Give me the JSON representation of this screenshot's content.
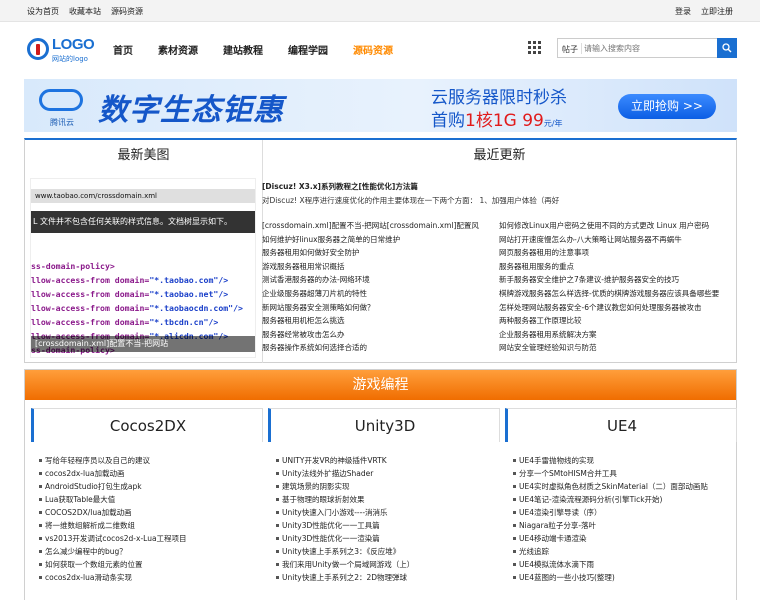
{
  "topbar": {
    "set_home": "设为首页",
    "bookmark": "收藏本站",
    "source": "源码资源",
    "login": "登录",
    "register": "立即注册"
  },
  "logo": {
    "text": "LOGO",
    "sub": "网站的logo"
  },
  "nav": [
    "首页",
    "素材资源",
    "建站教程",
    "编程学园",
    "源码资源"
  ],
  "nav_active_index": 4,
  "search": {
    "category": "帖子",
    "placeholder": "请输入搜索内容"
  },
  "banner": {
    "brand": "腾讯云",
    "headline": "数字生态钜惠",
    "sub1": "云服务器限时秒杀",
    "sub2_prefix": "首购",
    "sub2_highlight": "1核1G 99",
    "sub2_suffix": "元/年",
    "cta": "立即抢购 >>"
  },
  "gallery": {
    "title": "最新美图",
    "url_text": "www.taobao.com/crossdomain.xml",
    "note": "L 文件并不包含任何关联的样式信息。文档树显示如下。",
    "code_lines": [
      {
        "tag": "ss-domain-policy>",
        "val": ""
      },
      {
        "tag": "llow-access-from domain=",
        "val": "\"*.taobao.com\"/>"
      },
      {
        "tag": "llow-access-from domain=",
        "val": "\"*.taobao.net\"/>"
      },
      {
        "tag": "llow-access-from domain=",
        "val": "\"*.taobaocdn.com\"/>"
      },
      {
        "tag": "llow-access-from domain=",
        "val": "\"*.tbcdn.cn\"/>"
      },
      {
        "tag": "llow-access-from domain=",
        "val": "\"*.alicdn.com\"/>"
      },
      {
        "tag": "ss-domain-policy>",
        "val": ""
      }
    ],
    "caption": "[crossdomain.xml]配置不当-把网站"
  },
  "latest": {
    "title": "最近更新",
    "feature_title": "[Discuz! X3.x]系列教程之[性能优化]方法篇",
    "feature_desc": "对Discuz! X程序进行速度优化的作用主要体现在一下两个方面： 1、加强用户体验（再好",
    "rows": [
      [
        "[crossdomain.xml]配置不当-把网站[crossdomain.xml]配置风",
        "如何修改Linux用户密码之使用不同的方式更改 Linux 用户密码"
      ],
      [
        "如何维护好linux服务器之简单的日常维护",
        "网站打开速度慢怎么办-八大策略让网站服务器不再蜗牛"
      ],
      [
        "服务器租用如何做好安全防护",
        "网页服务器租用的注意事项"
      ],
      [
        "游戏服务器租用常识概括",
        "服务器租用服务的重点"
      ],
      [
        "测试香港服务器的办法-网络环境",
        "新手服务器安全维护之7条建议-维护服务器安全的技巧"
      ],
      [
        "企业级服务器超薄刀片机的特性",
        "棋牌游戏服务器怎么样选择-优质的棋牌游戏服务器应该具备哪些要"
      ],
      [
        "新网站服务器安全测策略如何做？",
        "怎样处理网站服务器安全-6个建议教您如何处理服务器被攻击"
      ],
      [
        "服务器租用机柜怎么挑选",
        "两种服务器工作原理比较"
      ],
      [
        "服务器经常被攻击怎么办",
        "企业服务器租用系统解决方案"
      ],
      [
        "服务器操作系统如何选择合适的",
        "网站安全管理经验知识与防范"
      ]
    ]
  },
  "game": {
    "title": "游戏编程",
    "columns": [
      {
        "title": "Cocos2DX",
        "items": [
          "写给年轻程序员以及自己的建议",
          "cocos2dx-lua加载动画",
          "AndroidStudio打包生成apk",
          "Lua获取Table最大值",
          "COCOS2DX/lua加载动画",
          "将一维数组解析成二维数组",
          "vs2013开发调试cocos2d-x-Lua工程项目",
          "怎么减少编程中的bug？",
          "如何获取一个数组元素的位置",
          "cocos2dx-lua滑动条实现"
        ]
      },
      {
        "title": "Unity3D",
        "items": [
          "UNITY开发VR的神级插件VRTK",
          "Unity法线外扩描边Shader",
          "建筑场景的阴影实现",
          "基于物理的眼球折射效果",
          "Unity快速入门小游戏----消消乐",
          "Unity3D性能优化一一工具篇",
          "Unity3D性能优化一一渲染篇",
          "Unity快速上手系列之3：《反应堆》",
          "我们来用Unity做一个局域网游戏（上）",
          "Unity快速上手系列之2：2D物理弹球"
        ]
      },
      {
        "title": "UE4",
        "items": [
          "UE4手雷抛物线的实现",
          "分享一个SMtoHISM合并工具",
          "UE4实时虚拟角色材质之SkinMaterial（二）面部动画贴",
          "UE4笔记-渲染流程源码分析(引擎Tick开始)",
          "UE4渲染引擎导读（序）",
          "Niagara粒子分享-落叶",
          "UE4移动端卡通渲染",
          "光线追踪",
          "UE4模拟流体水滴下雨",
          "UE4蓝图的一些小技巧(整理)"
        ]
      }
    ]
  }
}
